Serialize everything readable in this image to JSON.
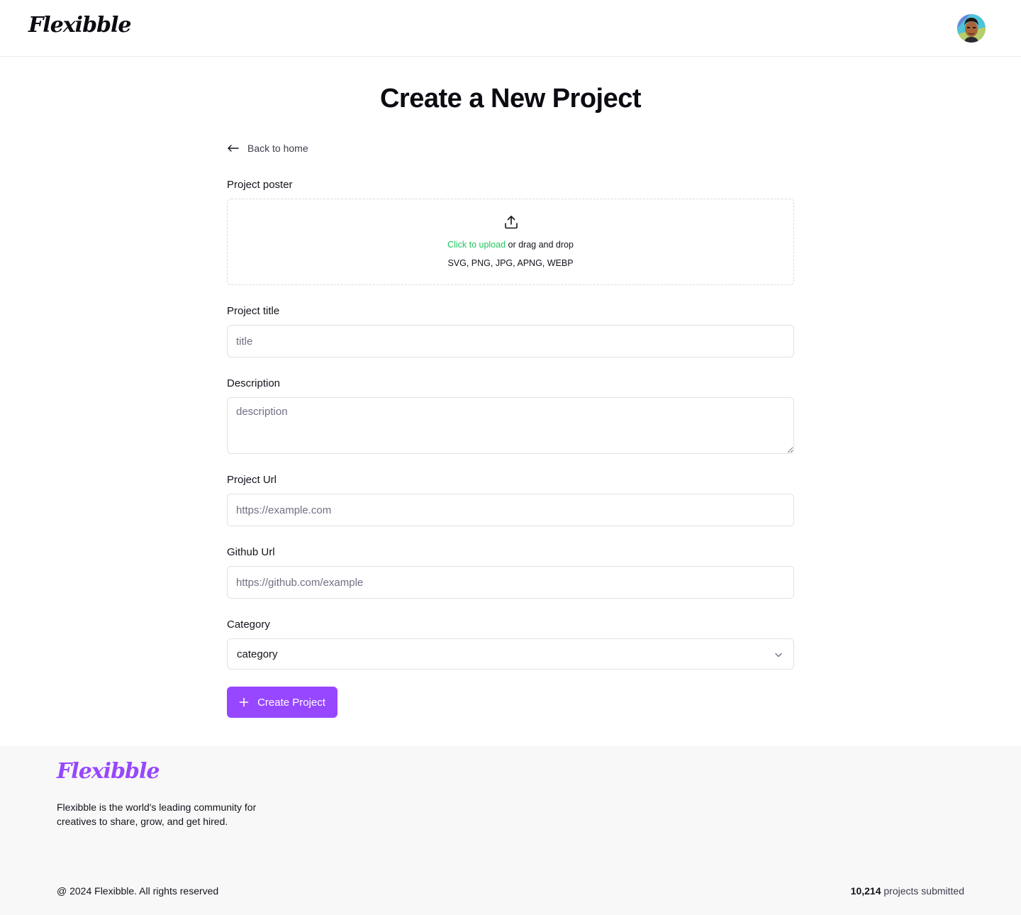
{
  "header": {
    "logo": "Flexibble"
  },
  "main": {
    "title": "Create a New Project",
    "back_link": "Back to home",
    "poster": {
      "label": "Project poster",
      "upload_link": "Click to upload",
      "upload_text": " or drag and drop",
      "formats": "SVG, PNG, JPG, APNG, WEBP"
    },
    "title_field": {
      "label": "Project title",
      "placeholder": "title"
    },
    "description_field": {
      "label": "Description",
      "placeholder": "description"
    },
    "url_field": {
      "label": "Project Url",
      "placeholder": "https://example.com"
    },
    "github_field": {
      "label": "Github Url",
      "placeholder": "https://github.com/example"
    },
    "category_field": {
      "label": "Category",
      "value": "category"
    },
    "submit_label": "Create Project"
  },
  "footer": {
    "logo": "Flexibble",
    "tagline": "Flexibble is the world's leading community for creatives to share, grow, and get hired.",
    "copyright": "@ 2024 Flexibble. All rights reserved",
    "count": "10,214",
    "count_suffix": " projects submitted"
  },
  "colors": {
    "accent": "#9747ff",
    "upload_link": "#22c55e",
    "footer_bg": "#f8f8f8"
  },
  "icons": [
    "arrow-left-icon",
    "upload-icon",
    "chevron-down-icon",
    "plus-icon"
  ]
}
